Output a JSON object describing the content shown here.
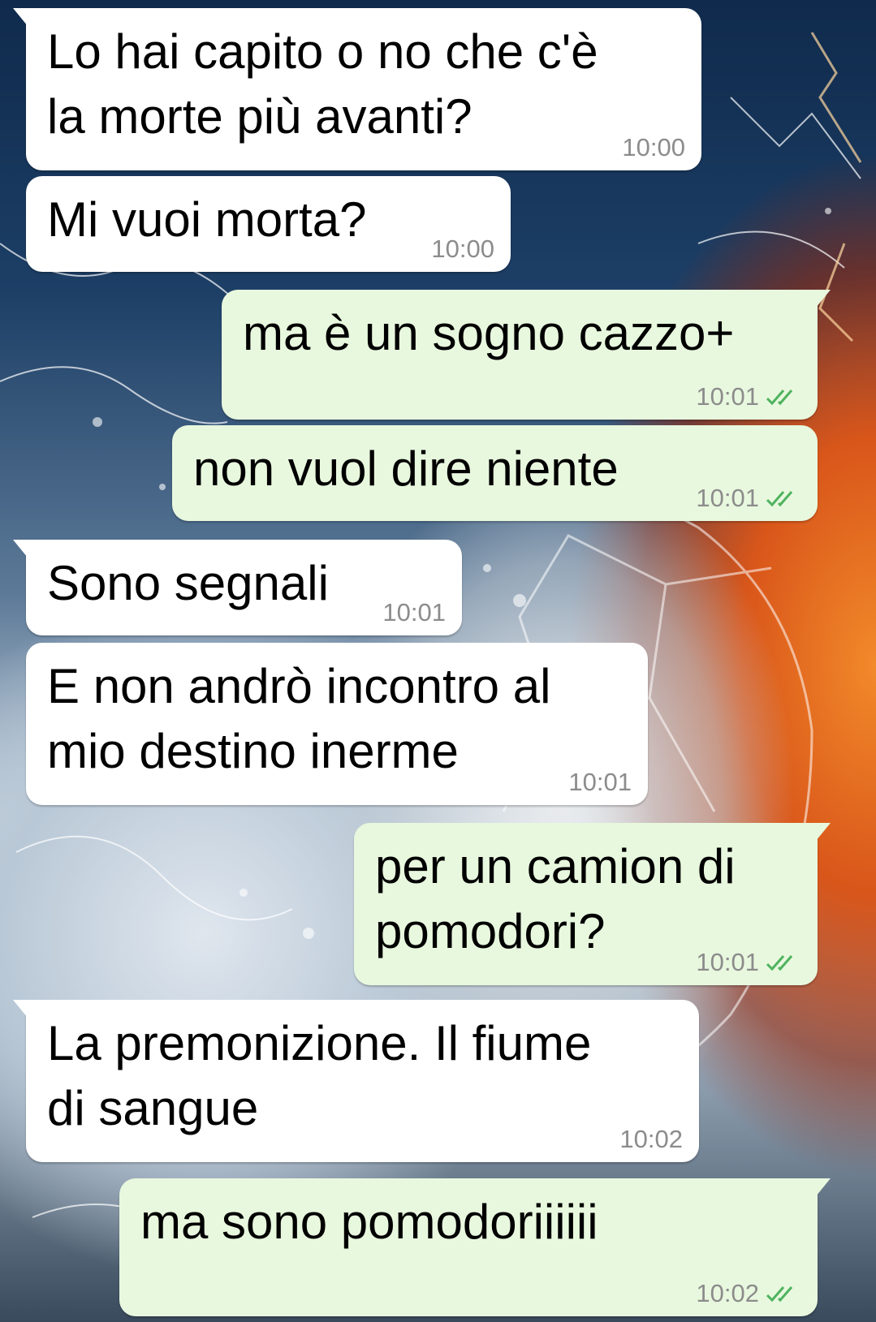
{
  "messages": [
    {
      "direction": "incoming",
      "text": "Lo hai capito o no che c'è\nla morte più avanti?",
      "time": "10:00"
    },
    {
      "direction": "incoming",
      "text": "Mi vuoi morta?",
      "time": "10:00"
    },
    {
      "direction": "outgoing",
      "text": "ma è un sogno cazzo+",
      "time": "10:01",
      "status": "read"
    },
    {
      "direction": "outgoing",
      "text": "non vuol dire niente",
      "time": "10:01",
      "status": "read"
    },
    {
      "direction": "incoming",
      "text": "Sono segnali",
      "time": "10:01"
    },
    {
      "direction": "incoming",
      "text": "E non andrò incontro al\nmio destino inerme",
      "time": "10:01"
    },
    {
      "direction": "outgoing",
      "text": "per un camion di\npomodori?",
      "time": "10:01",
      "status": "read"
    },
    {
      "direction": "incoming",
      "text": "La premonizione. Il fiume\ndi sangue",
      "time": "10:02"
    },
    {
      "direction": "outgoing",
      "text": "ma sono pomodoriiiiii",
      "time": "10:02",
      "status": "read"
    }
  ],
  "colors": {
    "incoming_bubble": "#ffffff",
    "outgoing_bubble": "#e8f8de",
    "timestamp": "#8c8c8c",
    "read_ticks": "#4fb35f"
  },
  "icons": {
    "read_receipt": "double-check-icon",
    "wallpaper": "soccer-ball-water-fire-wallpaper"
  }
}
